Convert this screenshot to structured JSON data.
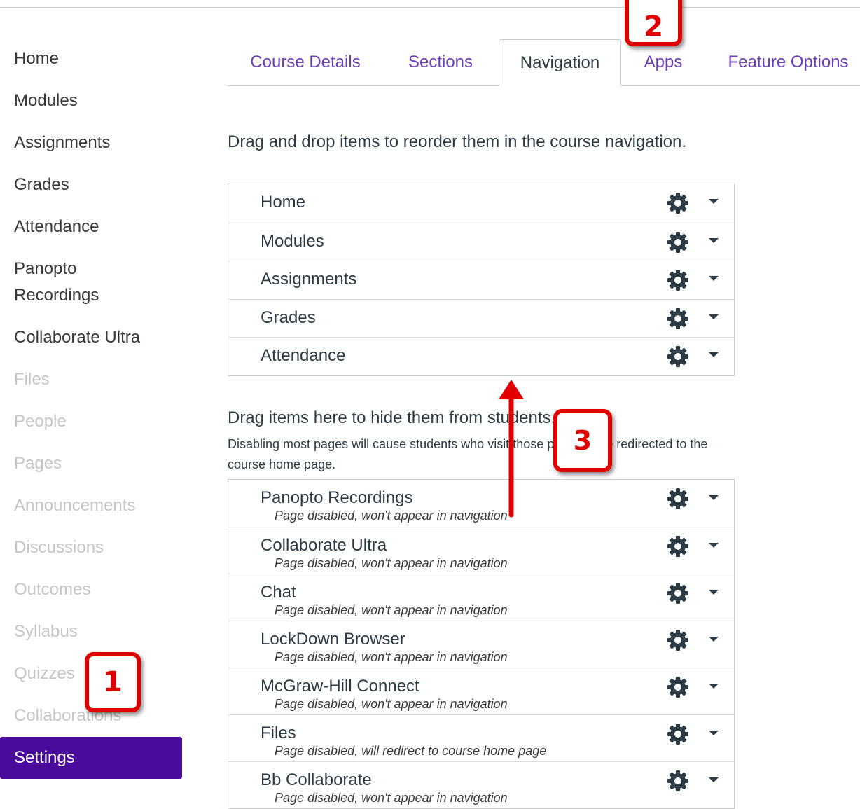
{
  "sidebar": {
    "items": [
      {
        "label": "Home",
        "state": "enabled"
      },
      {
        "label": "Modules",
        "state": "enabled"
      },
      {
        "label": "Assignments",
        "state": "enabled"
      },
      {
        "label": "Grades",
        "state": "enabled"
      },
      {
        "label": "Attendance",
        "state": "enabled"
      },
      {
        "label": "Panopto",
        "label2": "Recordings",
        "state": "enabled"
      },
      {
        "label": "Collaborate Ultra",
        "state": "enabled"
      },
      {
        "label": "Files",
        "state": "disabled"
      },
      {
        "label": "People",
        "state": "disabled"
      },
      {
        "label": "Pages",
        "state": "disabled"
      },
      {
        "label": "Announcements",
        "state": "disabled"
      },
      {
        "label": "Discussions",
        "state": "disabled"
      },
      {
        "label": "Outcomes",
        "state": "disabled"
      },
      {
        "label": "Syllabus",
        "state": "disabled"
      },
      {
        "label": "Quizzes",
        "state": "disabled"
      },
      {
        "label": "Collaborations",
        "state": "disabled"
      },
      {
        "label": "Settings",
        "state": "active"
      }
    ]
  },
  "tabs": [
    {
      "label": "Course Details"
    },
    {
      "label": "Sections"
    },
    {
      "label": "Navigation",
      "active": true
    },
    {
      "label": "Apps"
    },
    {
      "label": "Feature Options"
    }
  ],
  "intro": "Drag and drop items to reorder them in the course navigation.",
  "enabled_items": [
    {
      "label": "Home"
    },
    {
      "label": "Modules"
    },
    {
      "label": "Assignments"
    },
    {
      "label": "Grades"
    },
    {
      "label": "Attendance"
    }
  ],
  "hidden_section": {
    "title": "Drag items here to hide them from students.",
    "description": "Disabling most pages will cause students who visit those pages to be redirected to the course home page."
  },
  "disabled_items": [
    {
      "label": "Panopto Recordings",
      "note": "Page disabled, won't appear in navigation"
    },
    {
      "label": "Collaborate Ultra",
      "note": "Page disabled, won't appear in navigation"
    },
    {
      "label": "Chat",
      "note": "Page disabled, won't appear in navigation"
    },
    {
      "label": "LockDown Browser",
      "note": "Page disabled, won't appear in navigation"
    },
    {
      "label": "McGraw-Hill Connect",
      "note": "Page disabled, won't appear in navigation"
    },
    {
      "label": "Files",
      "note": "Page disabled, will redirect to course home page"
    },
    {
      "label": "Bb Collaborate",
      "note": "Page disabled, won't appear in navigation"
    }
  ],
  "callouts": {
    "one": "1",
    "two": "2",
    "three": "3"
  },
  "icons": {
    "row_settings": "gear-icon",
    "row_menu": "caret-down-icon"
  },
  "colors": {
    "accent": "#4a0a9c",
    "tab_link": "#6b3ec1",
    "callout": "#e00000"
  }
}
